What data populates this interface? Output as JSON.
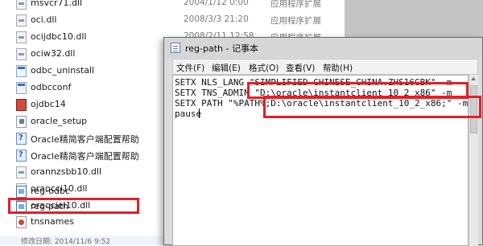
{
  "file_list": [
    {
      "name": "msvcr71.dll",
      "date": "2004/1/12 0:00",
      "type": "应用程序扩展",
      "icon": "dll-icon"
    },
    {
      "name": "oci.dll",
      "date": "2008/3/3 21:20",
      "type": "应用程序扩展",
      "icon": "dll-icon"
    },
    {
      "name": "ocijdbc10.dll",
      "date": "2008/2/11 12:58",
      "type": "应用程序扩展",
      "icon": "dll-icon"
    },
    {
      "name": "ociw32.dll",
      "date": "",
      "type": "",
      "icon": "dll-icon"
    },
    {
      "name": "odbc_uninstall",
      "date": "",
      "type": "",
      "icon": "exe-icon"
    },
    {
      "name": "odbcconf",
      "date": "",
      "type": "",
      "icon": "exe-icon"
    },
    {
      "name": "ojdbc14",
      "date": "",
      "type": "",
      "icon": "jar-icon"
    },
    {
      "name": "oracle_setup",
      "date": "",
      "type": "",
      "icon": "batch-icon"
    },
    {
      "name": "Oracle精简客户端配置帮助",
      "date": "",
      "type": "",
      "icon": "help-icon"
    },
    {
      "name": "Oracle精简客户端配置帮助",
      "date": "",
      "type": "",
      "icon": "help-icon"
    },
    {
      "name": "orannzsbb10.dll",
      "date": "",
      "type": "",
      "icon": "dll-icon"
    },
    {
      "name": "oraocci10.dll",
      "date": "",
      "type": "",
      "icon": "dll-icon"
    },
    {
      "name": "oraociei10.dll",
      "date": "",
      "type": "",
      "icon": "dll-icon"
    },
    {
      "name": "reg-odbc",
      "date": "",
      "type": "",
      "icon": "reg-icon"
    },
    {
      "name": "reg-path",
      "date": "",
      "type": "",
      "icon": "reg-icon"
    },
    {
      "name": "tnsnames",
      "date": "",
      "type": "",
      "icon": "oracle-icon"
    }
  ],
  "status_bar": {
    "text": "修改日期: 2014/11/6 9:52"
  },
  "notepad": {
    "title": "reg-path - 记事本",
    "menu": [
      {
        "label": "文件(F)"
      },
      {
        "label": "编辑(E)"
      },
      {
        "label": "格式(O)"
      },
      {
        "label": "查看(V)"
      },
      {
        "label": "帮助(H)"
      }
    ],
    "lines": [
      "SETX NLS_LANG \"SIMPLIFIED CHINESE_CHINA.ZHS16GBK\" -m",
      "SETX TNS_ADMIN \"D:\\oracle\\instantclient_10_2_x86\" -m",
      "SETX PATH \"%PATH%;D:\\oracle\\instantclient_10_2_x86;\" -m",
      "pause"
    ]
  },
  "colors": {
    "highlight": "#e0202a"
  }
}
